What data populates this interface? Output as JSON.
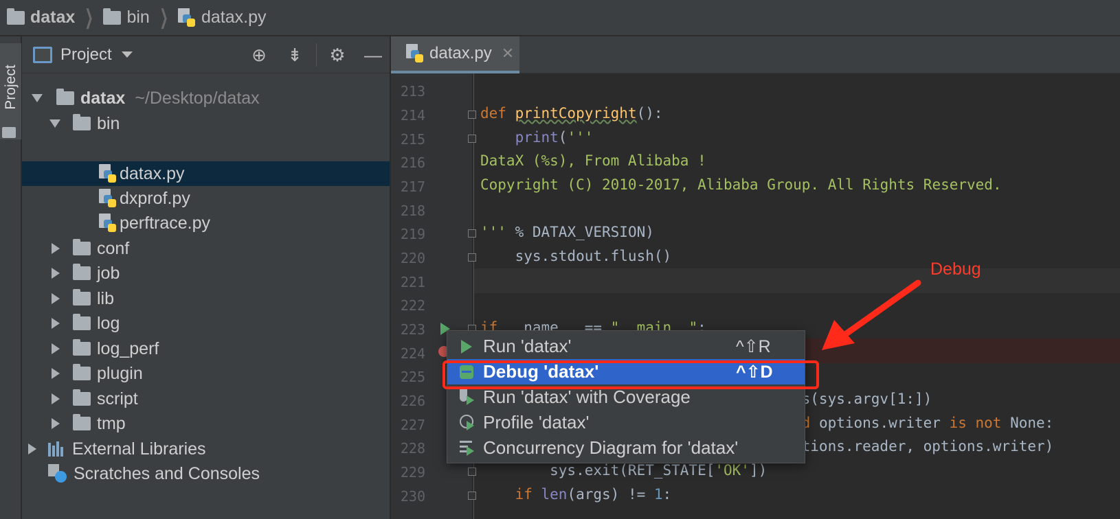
{
  "breadcrumb": [
    {
      "label": "datax",
      "icon": "folder-icon"
    },
    {
      "label": "bin",
      "icon": "folder-icon"
    },
    {
      "label": "datax.py",
      "icon": "python-file-icon"
    }
  ],
  "tool_strip": {
    "project_tab": "Project"
  },
  "project_panel": {
    "title": "Project",
    "tree": [
      {
        "label": "datax",
        "path": "~/Desktop/datax",
        "level": 0,
        "expanded": true,
        "type": "folder"
      },
      {
        "label": "bin",
        "level": 1,
        "expanded": true,
        "type": "folder"
      },
      {
        "label": "datax.py",
        "level": 2,
        "type": "python",
        "selected": true
      },
      {
        "label": "dxprof.py",
        "level": 2,
        "type": "python"
      },
      {
        "label": "perftrace.py",
        "level": 2,
        "type": "python"
      },
      {
        "label": "conf",
        "level": 1,
        "expanded": false,
        "type": "folder"
      },
      {
        "label": "job",
        "level": 1,
        "expanded": false,
        "type": "folder"
      },
      {
        "label": "lib",
        "level": 1,
        "expanded": false,
        "type": "folder"
      },
      {
        "label": "log",
        "level": 1,
        "expanded": false,
        "type": "folder"
      },
      {
        "label": "log_perf",
        "level": 1,
        "expanded": false,
        "type": "folder"
      },
      {
        "label": "plugin",
        "level": 1,
        "expanded": false,
        "type": "folder"
      },
      {
        "label": "script",
        "level": 1,
        "expanded": false,
        "type": "folder"
      },
      {
        "label": "tmp",
        "level": 1,
        "expanded": false,
        "type": "folder"
      },
      {
        "label": "External Libraries",
        "level": 0,
        "expanded": false,
        "type": "library"
      },
      {
        "label": "Scratches and Consoles",
        "level": 0,
        "type": "scratch"
      }
    ]
  },
  "editor": {
    "tab": "datax.py",
    "line_numbers": [
      "213",
      "214",
      "215",
      "216",
      "217",
      "218",
      "219",
      "220",
      "221",
      "222",
      "223",
      "224",
      "225",
      "226",
      "227",
      "228",
      "229",
      "230"
    ],
    "code": {
      "l214_kw": "def ",
      "l214_fn": "printCopyright",
      "l214_rest": "():",
      "l215_bi": "    print",
      "l215_rest": "(",
      "l215_str": "'''",
      "l216": "DataX (%s), From Alibaba !",
      "l217": "Copyright (C) 2010-2017, Alibaba Group. All Rights Reserved.",
      "l219_str": "'''",
      "l219_rest": " % DATAX_VERSION)",
      "l220": "    sys.stdout.flush()",
      "l223_kw": "if",
      "l223_rest": " __name__ == ",
      "l223_str": "\"__main__\"",
      "l223_end": ":",
      "l226": "gs(sys.argv[1:])",
      "l227_kw": "nd",
      "l227_rest": " options.writer ",
      "l227_kw2": "is not",
      "l227_rest2": " None:",
      "l228": "ptions.reader, options.writer)",
      "l229_a": "        sys.exit(RET_STATE[",
      "l229_str": "'OK'",
      "l229_b": "])",
      "l230_kw": "    if ",
      "l230_bi": "len",
      "l230_rest": "(args) != ",
      "l230_num": "1",
      "l230_end": ":"
    }
  },
  "context_menu": {
    "items": [
      {
        "label": "Run 'datax'",
        "shortcut": "^⇧R",
        "icon": "run-icon"
      },
      {
        "label": "Debug 'datax'",
        "shortcut": "^⇧D",
        "icon": "debug-icon",
        "selected": true
      },
      {
        "label": "Run 'datax' with Coverage",
        "shortcut": "",
        "icon": "coverage-icon"
      },
      {
        "label": "Profile 'datax'",
        "shortcut": "",
        "icon": "profile-icon"
      },
      {
        "label": "Concurrency Diagram for 'datax'",
        "shortcut": "",
        "icon": "concurrency-icon"
      }
    ]
  },
  "annotation": {
    "label": "Debug",
    "color": "#ff3b2a"
  }
}
